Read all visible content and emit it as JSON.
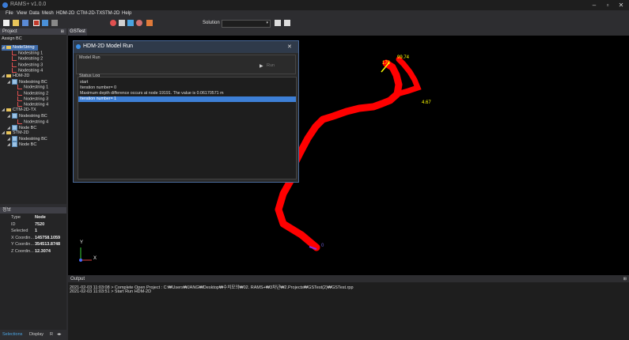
{
  "app": {
    "title": "RAMS+ v1.0.0"
  },
  "menu": [
    "File",
    "View",
    "Data",
    "Mesh",
    "HDM-2D",
    "CTM-2D-TX",
    "STM-2D",
    "Help"
  ],
  "toolbar": {
    "solution_label": "Solution",
    "solution_value": ""
  },
  "project": {
    "header": "Project",
    "section": "Assign BC",
    "tree": [
      {
        "label": "NodeString",
        "kind": "folder",
        "level": 0,
        "selected": true
      },
      {
        "label": "Nodestring 1",
        "kind": "ns",
        "level": 1
      },
      {
        "label": "Nodestring 2",
        "kind": "ns",
        "level": 1
      },
      {
        "label": "Nodestring 3",
        "kind": "ns",
        "level": 1
      },
      {
        "label": "Nodestring 4",
        "kind": "ns",
        "level": 1
      },
      {
        "label": "HDM-2D",
        "kind": "folder",
        "level": 0
      },
      {
        "label": "Nodestring BC",
        "kind": "bc",
        "level": 1
      },
      {
        "label": "Nodestring 1",
        "kind": "ns",
        "level": 2
      },
      {
        "label": "Nodestring 2",
        "kind": "ns",
        "level": 2
      },
      {
        "label": "Nodestring 3",
        "kind": "ns",
        "level": 2
      },
      {
        "label": "Nodestring 4",
        "kind": "ns",
        "level": 2
      },
      {
        "label": "CTM-2D-TX",
        "kind": "folder",
        "level": 0
      },
      {
        "label": "Nodestring BC",
        "kind": "bc",
        "level": 1
      },
      {
        "label": "Nodestring 4",
        "kind": "ns",
        "level": 2
      },
      {
        "label": "Node BC",
        "kind": "bc",
        "level": 1
      },
      {
        "label": "STM-2D",
        "kind": "folder",
        "level": 0
      },
      {
        "label": "Nodestring BC",
        "kind": "bc",
        "level": 1
      },
      {
        "label": "Node BC",
        "kind": "bc",
        "level": 1
      }
    ]
  },
  "properties": {
    "header": "정보",
    "rows": [
      {
        "k": "Type",
        "v": "Node"
      },
      {
        "k": "ID",
        "v": "7520"
      },
      {
        "k": "Selected",
        "v": "1"
      },
      {
        "k": "X Coordin...",
        "v": "145758.1059"
      },
      {
        "k": "Y Coordin...",
        "v": "354513.8748"
      },
      {
        "k": "Z Coordin...",
        "v": "12.3074"
      }
    ]
  },
  "bottom_tabs": [
    "Selections",
    "Display",
    "R"
  ],
  "document_tab": "GSTest",
  "viewport": {
    "labels": {
      "l178": "178",
      "l9974": "99.74",
      "l467": "4.67",
      "l0": "0"
    },
    "axis": {
      "x": "X",
      "y": "Y"
    }
  },
  "dialog": {
    "title": "HDM-2D Model Run",
    "group_run": "Model Run",
    "run_button": "Run",
    "group_status": "Status Log",
    "log": [
      "start",
      "Iteration number=   0",
      "Maximum depth difference occurs at node 19191. The value is   0.06170571 m",
      "Iteration number=   1"
    ]
  },
  "output": {
    "header": "Output",
    "lines": [
      "2021-02-03 11:03:08 > Complete Open Project : C:₩Users₩JANG₩Desktop₩수치모의₩02. RAMS+₩3차년₩2.Projects₩GSTest(2)₩GSTest.rpp",
      "2021-02-03 11:03:51 > Start Run HDM-2D"
    ]
  }
}
